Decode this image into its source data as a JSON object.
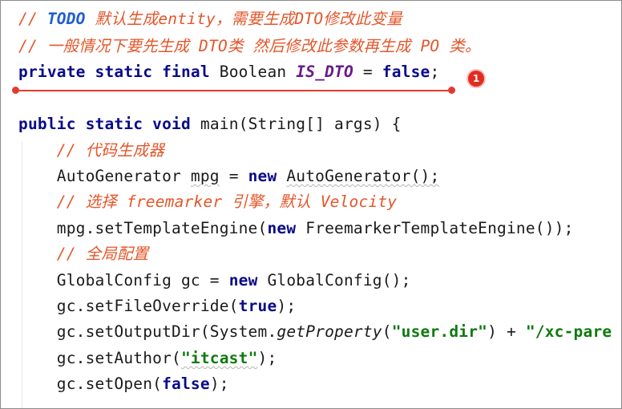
{
  "lines": [
    {
      "segments": [
        {
          "cls": "cm",
          "t": "// "
        },
        {
          "cls": "cmb",
          "t": "TODO"
        },
        {
          "cls": "cm",
          "t": " 默认生成entity，需要生成DTO修改此变量"
        }
      ]
    },
    {
      "segments": [
        {
          "cls": "cm",
          "t": "// 一般情况下要先生成 DTO类 然后修改此参数再生成 PO 类。"
        }
      ]
    },
    {
      "segments": [
        {
          "cls": "kw",
          "t": "private static final "
        },
        {
          "cls": "",
          "t": "Boolean "
        },
        {
          "cls": "fld",
          "t": "IS_DTO"
        },
        {
          "cls": "",
          "t": " = "
        },
        {
          "cls": "kw",
          "t": "false"
        },
        {
          "cls": "",
          "t": ";"
        }
      ]
    },
    {
      "segments": []
    },
    {
      "segments": [
        {
          "cls": "kw",
          "t": "public static void "
        },
        {
          "cls": "",
          "t": "main(String[] args) {"
        }
      ]
    },
    {
      "segments": [
        {
          "cls": "",
          "t": "    "
        },
        {
          "cls": "cm",
          "t": "// 代码生成器"
        }
      ]
    },
    {
      "segments": [
        {
          "cls": "",
          "t": "    AutoGenerator "
        },
        {
          "cls": "squig",
          "t": "mpg"
        },
        {
          "cls": "",
          "t": " = "
        },
        {
          "cls": "kw",
          "t": "new "
        },
        {
          "cls": "squig",
          "t": "AutoGenerator();"
        }
      ]
    },
    {
      "segments": [
        {
          "cls": "",
          "t": "    "
        },
        {
          "cls": "cm",
          "t": "// 选择 freemarker 引擎，默认 Velocity"
        }
      ]
    },
    {
      "segments": [
        {
          "cls": "",
          "t": "    mpg.setTemplateEngine("
        },
        {
          "cls": "kw",
          "t": "new "
        },
        {
          "cls": "",
          "t": "FreemarkerTemplateEngine());"
        }
      ]
    },
    {
      "segments": [
        {
          "cls": "",
          "t": "    "
        },
        {
          "cls": "cm",
          "t": "// 全局配置"
        }
      ]
    },
    {
      "segments": [
        {
          "cls": "",
          "t": "    GlobalConfig gc = "
        },
        {
          "cls": "kw",
          "t": "new "
        },
        {
          "cls": "",
          "t": "GlobalConfig();"
        }
      ]
    },
    {
      "segments": [
        {
          "cls": "",
          "t": "    gc.setFileOverride("
        },
        {
          "cls": "kw",
          "t": "true"
        },
        {
          "cls": "",
          "t": ");"
        }
      ]
    },
    {
      "segments": [
        {
          "cls": "",
          "t": "    gc.setOutputDir(System."
        },
        {
          "cls": "mth",
          "t": "getProperty"
        },
        {
          "cls": "",
          "t": "("
        },
        {
          "cls": "st",
          "t": "\"user.dir\""
        },
        {
          "cls": "",
          "t": ") + "
        },
        {
          "cls": "st",
          "t": "\"/xc-pare"
        }
      ]
    },
    {
      "segments": [
        {
          "cls": "",
          "t": "    gc.setAuthor("
        },
        {
          "cls": "st squig",
          "t": "\"itcast\""
        },
        {
          "cls": "",
          "t": ");"
        }
      ]
    },
    {
      "segments": [
        {
          "cls": "",
          "t": "    gc.setOpen("
        },
        {
          "cls": "kw",
          "t": "false"
        },
        {
          "cls": "",
          "t": ");"
        }
      ]
    }
  ],
  "badge_label": "1"
}
